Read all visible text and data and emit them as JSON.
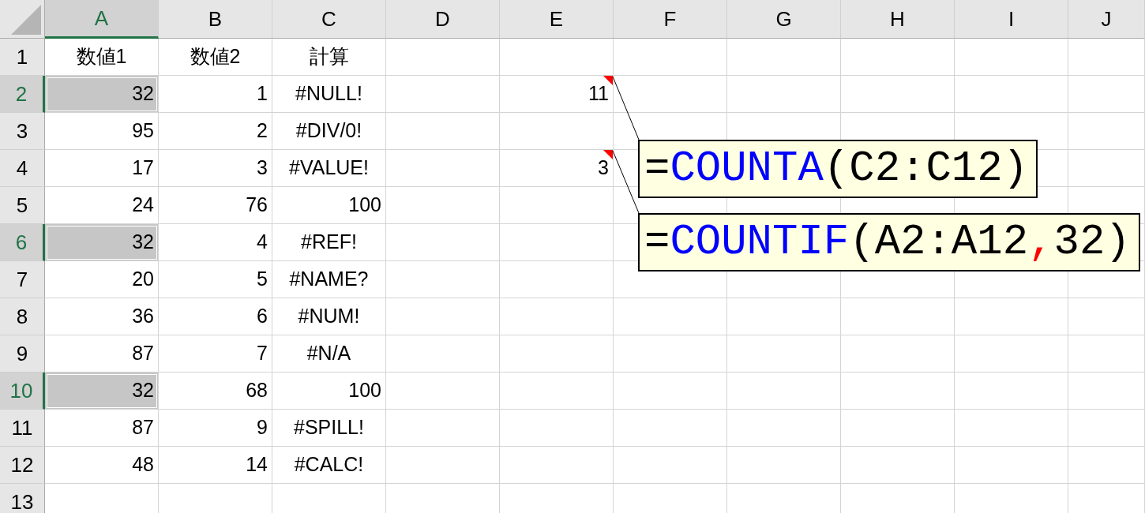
{
  "columns": [
    {
      "label": "A",
      "selected": true
    },
    {
      "label": "B",
      "selected": false
    },
    {
      "label": "C",
      "selected": false
    },
    {
      "label": "D",
      "selected": false
    },
    {
      "label": "E",
      "selected": false
    },
    {
      "label": "F",
      "selected": false
    },
    {
      "label": "G",
      "selected": false
    },
    {
      "label": "H",
      "selected": false
    },
    {
      "label": "I",
      "selected": false
    },
    {
      "label": "J",
      "selected": false
    }
  ],
  "rows": [
    {
      "number": "1",
      "selected": false,
      "cells": [
        {
          "text": "数値1",
          "kind": "text"
        },
        {
          "text": "数値2",
          "kind": "text"
        },
        {
          "text": "計算",
          "kind": "text"
        }
      ]
    },
    {
      "number": "2",
      "selected": true,
      "cells": [
        {
          "text": "32",
          "kind": "number"
        },
        {
          "text": "1",
          "kind": "number"
        },
        {
          "text": "#NULL!",
          "kind": "error"
        },
        null,
        {
          "text": "11",
          "kind": "number",
          "comment": {
            "segments": [
              {
                "text": "=",
                "color": "#000000"
              },
              {
                "text": "COUNTA",
                "color": "#0000ff"
              },
              {
                "text": "(C2:C12)",
                "color": "#000000"
              }
            ]
          }
        }
      ]
    },
    {
      "number": "3",
      "selected": false,
      "cells": [
        {
          "text": "95",
          "kind": "number"
        },
        {
          "text": "2",
          "kind": "number"
        },
        {
          "text": "#DIV/0!",
          "kind": "error"
        }
      ]
    },
    {
      "number": "4",
      "selected": false,
      "cells": [
        {
          "text": "17",
          "kind": "number"
        },
        {
          "text": "3",
          "kind": "number"
        },
        {
          "text": "#VALUE!",
          "kind": "error"
        },
        null,
        {
          "text": "3",
          "kind": "number",
          "comment": {
            "segments": [
              {
                "text": "=",
                "color": "#000000"
              },
              {
                "text": "COUNTIF",
                "color": "#0000ff"
              },
              {
                "text": "(A2:A12",
                "color": "#000000"
              },
              {
                "text": ",",
                "color": "#ff0000"
              },
              {
                "text": "32)",
                "color": "#000000"
              }
            ]
          }
        }
      ]
    },
    {
      "number": "5",
      "selected": false,
      "cells": [
        {
          "text": "24",
          "kind": "number"
        },
        {
          "text": "76",
          "kind": "number"
        },
        {
          "text": "100",
          "kind": "number"
        }
      ]
    },
    {
      "number": "6",
      "selected": true,
      "cells": [
        {
          "text": "32",
          "kind": "number"
        },
        {
          "text": "4",
          "kind": "number"
        },
        {
          "text": "#REF!",
          "kind": "error"
        }
      ]
    },
    {
      "number": "7",
      "selected": false,
      "cells": [
        {
          "text": "20",
          "kind": "number"
        },
        {
          "text": "5",
          "kind": "number"
        },
        {
          "text": "#NAME?",
          "kind": "error"
        }
      ]
    },
    {
      "number": "8",
      "selected": false,
      "cells": [
        {
          "text": "36",
          "kind": "number"
        },
        {
          "text": "6",
          "kind": "number"
        },
        {
          "text": "#NUM!",
          "kind": "error"
        }
      ]
    },
    {
      "number": "9",
      "selected": false,
      "cells": [
        {
          "text": "87",
          "kind": "number"
        },
        {
          "text": "7",
          "kind": "number"
        },
        {
          "text": "#N/A",
          "kind": "error"
        }
      ]
    },
    {
      "number": "10",
      "selected": true,
      "cells": [
        {
          "text": "32",
          "kind": "number"
        },
        {
          "text": "68",
          "kind": "number"
        },
        {
          "text": "100",
          "kind": "number"
        }
      ]
    },
    {
      "number": "11",
      "selected": false,
      "cells": [
        {
          "text": "87",
          "kind": "number"
        },
        {
          "text": "9",
          "kind": "number"
        },
        {
          "text": "#SPILL!",
          "kind": "error"
        }
      ]
    },
    {
      "number": "12",
      "selected": false,
      "cells": [
        {
          "text": "48",
          "kind": "number"
        },
        {
          "text": "14",
          "kind": "number"
        },
        {
          "text": "#CALC!",
          "kind": "error"
        }
      ]
    },
    {
      "number": "13",
      "selected": false
    }
  ]
}
